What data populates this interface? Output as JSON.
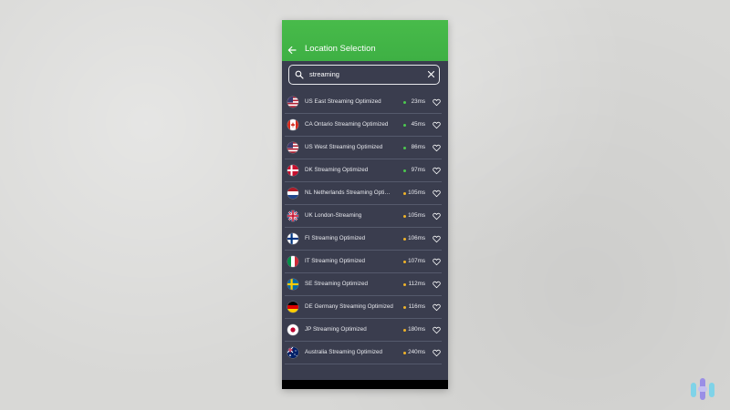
{
  "header": {
    "title": "Location Selection"
  },
  "search": {
    "value": "streaming"
  },
  "colors": {
    "header_green": "#45b649",
    "panel": "#3a3d4e",
    "ping_good": "#4cc94f",
    "ping_medium": "#f0b429"
  },
  "locations": [
    {
      "name": "US East Streaming Optimized",
      "ping": "23ms",
      "status": "good",
      "flag": "us-flag-icon"
    },
    {
      "name": "CA Ontario Streaming Optimized",
      "ping": "45ms",
      "status": "good",
      "flag": "ca-flag-icon"
    },
    {
      "name": "US West Streaming Optimized",
      "ping": "86ms",
      "status": "good",
      "flag": "us-flag-icon"
    },
    {
      "name": "DK Streaming Optimized",
      "ping": "97ms",
      "status": "good",
      "flag": "dk-flag-icon"
    },
    {
      "name": "NL Netherlands Streaming Optimized",
      "ping": "105ms",
      "status": "medium",
      "flag": "nl-flag-icon"
    },
    {
      "name": "UK London-Streaming",
      "ping": "105ms",
      "status": "medium",
      "flag": "uk-flag-icon"
    },
    {
      "name": "FI Streaming Optimized",
      "ping": "106ms",
      "status": "medium",
      "flag": "fi-flag-icon"
    },
    {
      "name": "IT Streaming Optimized",
      "ping": "107ms",
      "status": "medium",
      "flag": "it-flag-icon"
    },
    {
      "name": "SE Streaming Optimized",
      "ping": "112ms",
      "status": "medium",
      "flag": "se-flag-icon"
    },
    {
      "name": "DE Germany Streaming Optimized",
      "ping": "116ms",
      "status": "medium",
      "flag": "de-flag-icon"
    },
    {
      "name": "JP Streaming Optimized",
      "ping": "180ms",
      "status": "medium",
      "flag": "jp-flag-icon"
    },
    {
      "name": "Australia Streaming Optimized",
      "ping": "240ms",
      "status": "medium",
      "flag": "au-flag-icon"
    }
  ]
}
